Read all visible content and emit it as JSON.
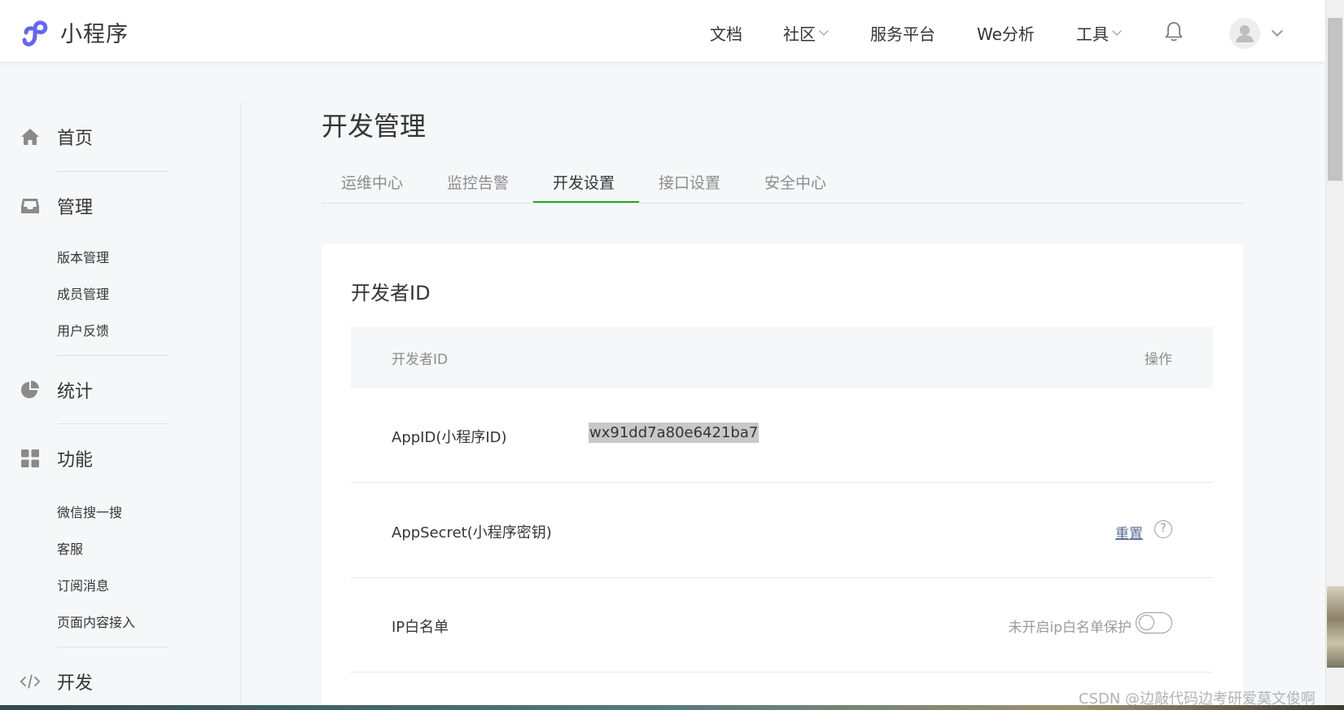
{
  "app": {
    "title": "小程序"
  },
  "topnav": {
    "items": [
      {
        "label": "文档",
        "dropdown": false
      },
      {
        "label": "社区",
        "dropdown": true
      },
      {
        "label": "服务平台",
        "dropdown": false
      },
      {
        "label": "We分析",
        "dropdown": false
      },
      {
        "label": "工具",
        "dropdown": true
      }
    ],
    "bell_icon": "bell-icon",
    "avatar_icon": "user-avatar-icon"
  },
  "sidebar": {
    "sections": [
      {
        "label": "首页",
        "icon": "home-icon"
      },
      {
        "label": "管理",
        "icon": "inbox-icon",
        "items": [
          "版本管理",
          "成员管理",
          "用户反馈"
        ]
      },
      {
        "label": "统计",
        "icon": "pie-chart-icon"
      },
      {
        "label": "功能",
        "icon": "grid-icon",
        "items": [
          "微信搜一搜",
          "客服",
          "订阅消息",
          "页面内容接入"
        ]
      },
      {
        "label": "开发",
        "icon": "code-icon"
      }
    ]
  },
  "main": {
    "title": "开发管理",
    "tabs": [
      "运维中心",
      "监控告警",
      "开发设置",
      "接口设置",
      "安全中心"
    ],
    "active_tab": "开发设置",
    "card": {
      "title": "开发者ID",
      "table_headers": {
        "left": "开发者ID",
        "right": "操作"
      },
      "rows": [
        {
          "label": "AppID(小程序ID)",
          "value": "wx91dd7a80e6421ba7"
        },
        {
          "label": "AppSecret(小程序密钥)",
          "action": "重置",
          "help_icon": "?"
        },
        {
          "label": "IP白名单",
          "status": "未开启ip白名单保护",
          "toggle_on": false
        }
      ]
    }
  },
  "watermark": "CSDN @边敲代码边考研爱莫文俊啊",
  "colors": {
    "accent_green": "#1aad19",
    "link": "#576b95",
    "logo": "#6467f0"
  }
}
